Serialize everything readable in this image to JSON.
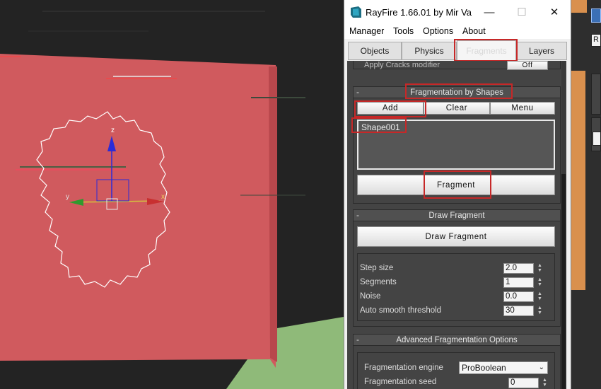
{
  "app": {
    "title": "RayFire 1.66.01  by Mir Va",
    "window_controls": {
      "minimize": "—",
      "maximize": "☐",
      "close": "✕"
    }
  },
  "menu": {
    "items": [
      "Manager",
      "Tools",
      "Options",
      "About"
    ]
  },
  "tabs": {
    "items": [
      "Objects",
      "Physics",
      "Fragments",
      "Layers"
    ],
    "active": "Fragments"
  },
  "rollouts": {
    "prev_partial": {
      "label": "Apply Cracks modifier",
      "value": "Off"
    },
    "frag_by_shapes": {
      "title": "Fragmentation by Shapes",
      "add_label": "Add",
      "clear_label": "Clear",
      "menu_label": "Menu",
      "shapes": [
        "Shape001"
      ],
      "fragment_label": "Fragment"
    },
    "draw_fragment": {
      "title": "Draw Fragment",
      "button_label": "Draw Fragment",
      "params": [
        {
          "label": "Step size",
          "value": "2.0"
        },
        {
          "label": "Segments",
          "value": "1"
        },
        {
          "label": "Noise",
          "value": "0.0"
        },
        {
          "label": "Auto smooth threshold",
          "value": "30"
        }
      ]
    },
    "advanced": {
      "title": "Advanced Fragmentation Options",
      "engine_label": "Fragmentation engine",
      "engine_value": "ProBoolean",
      "seed_label": "Fragmentation seed",
      "seed_value": "0"
    }
  },
  "viewport": {
    "axis_labels": {
      "z": "z",
      "x": "x",
      "y": "y"
    },
    "colors": {
      "wall": "#d05a5e",
      "ground": "#8fba79",
      "background": "#232323"
    }
  },
  "max_strip": {
    "field_label": "R"
  },
  "colors": {
    "highlight": "#c62828",
    "panel_bg": "#444444",
    "rollout_header": "#505050"
  }
}
